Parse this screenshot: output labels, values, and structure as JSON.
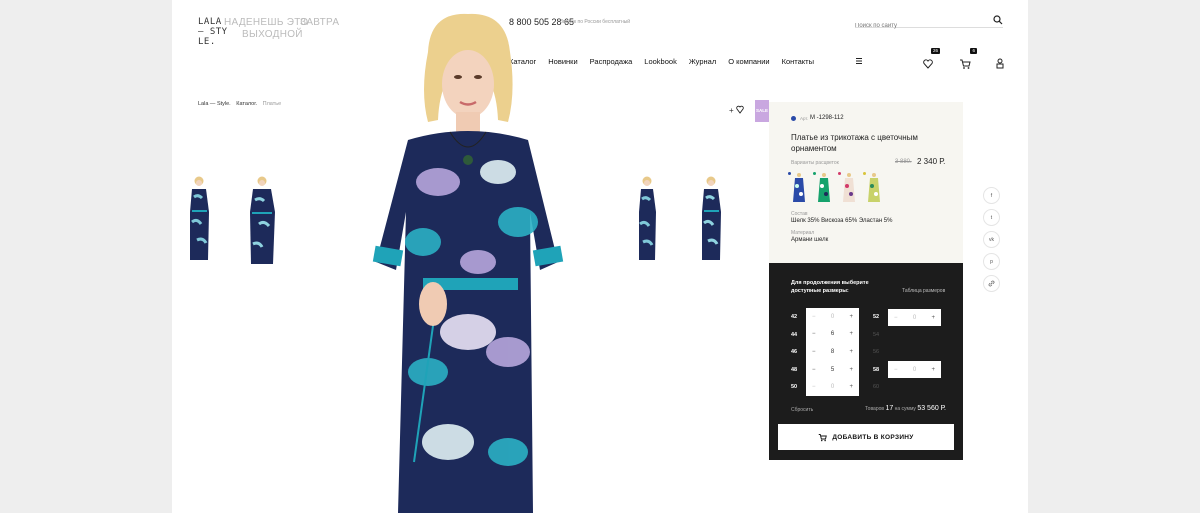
{
  "header": {
    "logo_lines": [
      "LALA",
      "— STY",
      "LE."
    ],
    "tagline": [
      "НАДЕНЕШЬ ЭТО",
      "ЗАВТРА",
      "ВЫХОДНОЙ"
    ],
    "phone": "8 800 505 28 65",
    "phone_note": "Звонок по России бесплатный",
    "search_placeholder": "Поиск по сайту",
    "nav": [
      "Каталог",
      "Новинки",
      "Распродажа",
      "Lookbook",
      "Журнал",
      "О компании",
      "Контакты"
    ],
    "favorites_count": "26",
    "cart_count": "6"
  },
  "breadcrumbs": [
    {
      "label": "Lala — Style."
    },
    {
      "label": "Каталог."
    },
    {
      "label": "Платье"
    }
  ],
  "product": {
    "sale_badge": "SALE",
    "add_favorite": "+",
    "article_label": "Арт.",
    "article": "М -1298-112",
    "title": "Платье из трикотажа с цветочным орнаментом",
    "variants_label": "Варианты расцветок",
    "old_price": "3 880.",
    "price": "2 340 Р.",
    "composition_label": "Состав",
    "composition": "Шелк 35%   Вискоза 65%   Эластан 5%",
    "material_label": "Материал",
    "material": "Армани шелк",
    "swatch_colors": [
      "#2a4aa8",
      "#16a26c",
      "#d23a6a",
      "#d8c43a"
    ]
  },
  "sizes": {
    "title": "Для продолжения выберите доступные размеры:",
    "table_link": "Таблица размеров",
    "left": [
      {
        "size": "42",
        "qty": "0",
        "active": false
      },
      {
        "size": "44",
        "qty": "6",
        "active": true
      },
      {
        "size": "46",
        "qty": "8",
        "active": true
      },
      {
        "size": "48",
        "qty": "5",
        "active": true
      },
      {
        "size": "50",
        "qty": "0",
        "active": false
      }
    ],
    "right": [
      {
        "size": "52",
        "qty": "0",
        "available": true
      },
      {
        "size": "54",
        "available": false
      },
      {
        "size": "56",
        "available": false
      },
      {
        "size": "58",
        "qty": "0",
        "available": true
      },
      {
        "size": "60",
        "available": false
      }
    ],
    "reset": "Сбросить",
    "total_prefix": "Товаров",
    "total_count": "17",
    "total_mid": "на сумму",
    "total_sum": "53 560 Р.",
    "add_to_cart": "ДОБАВИТЬ В КОРЗИНУ"
  },
  "social": [
    "f",
    "t",
    "vk",
    "p",
    "link"
  ],
  "colors": {
    "accent_dark": "#1c1c1c",
    "sale": "#c9a7e0",
    "card_bg": "#f7f6f1",
    "dress_navy": "#1d2a5a",
    "dress_teal": "#1fa3b8"
  }
}
